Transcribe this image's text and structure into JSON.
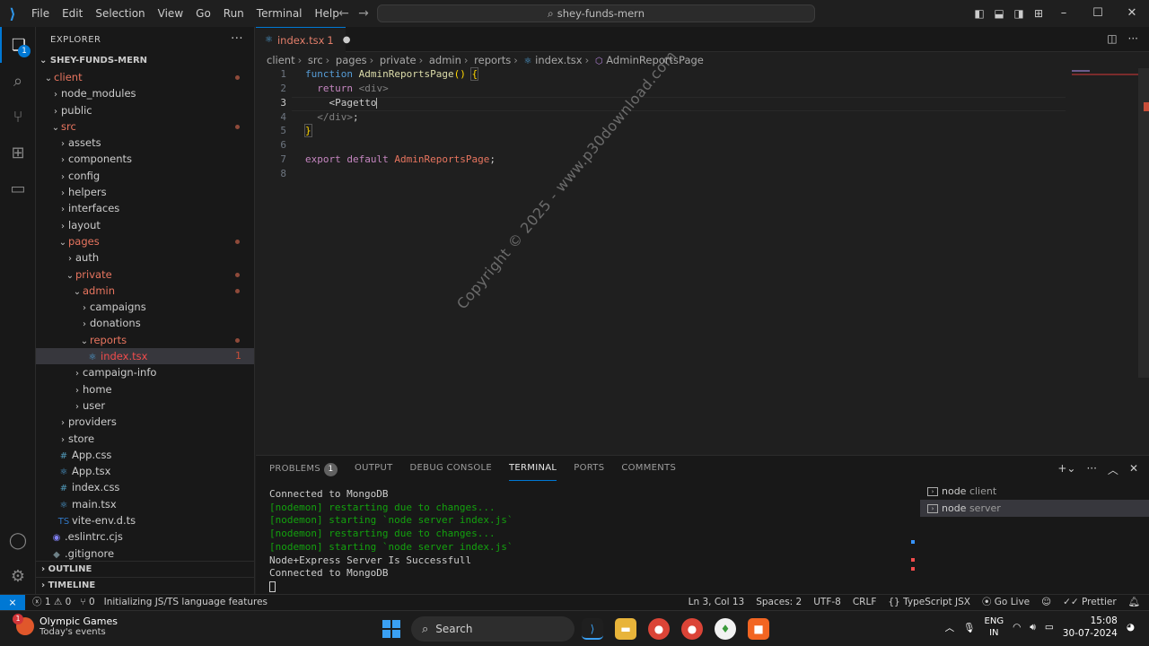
{
  "titlebar": {
    "menu": [
      "File",
      "Edit",
      "Selection",
      "View",
      "Go",
      "Run",
      "Terminal",
      "Help"
    ],
    "command_center": "shey-funds-mern"
  },
  "explorer": {
    "title": "EXPLORER",
    "root": "SHEY-FUNDS-MERN",
    "tree": [
      {
        "label": "client",
        "depth": 0,
        "type": "folder-open",
        "state": "dot"
      },
      {
        "label": "node_modules",
        "depth": 1,
        "type": "folder",
        "state": ""
      },
      {
        "label": "public",
        "depth": 1,
        "type": "folder",
        "state": ""
      },
      {
        "label": "src",
        "depth": 1,
        "type": "folder-open",
        "state": "dot"
      },
      {
        "label": "assets",
        "depth": 2,
        "type": "folder",
        "state": ""
      },
      {
        "label": "components",
        "depth": 2,
        "type": "folder",
        "state": ""
      },
      {
        "label": "config",
        "depth": 2,
        "type": "folder",
        "state": ""
      },
      {
        "label": "helpers",
        "depth": 2,
        "type": "folder",
        "state": ""
      },
      {
        "label": "interfaces",
        "depth": 2,
        "type": "folder",
        "state": ""
      },
      {
        "label": "layout",
        "depth": 2,
        "type": "folder",
        "state": ""
      },
      {
        "label": "pages",
        "depth": 2,
        "type": "folder-open",
        "state": "dot"
      },
      {
        "label": "auth",
        "depth": 3,
        "type": "folder",
        "state": ""
      },
      {
        "label": "private",
        "depth": 3,
        "type": "folder-open",
        "state": "dot"
      },
      {
        "label": "admin",
        "depth": 4,
        "type": "folder-open",
        "state": "dot"
      },
      {
        "label": "campaigns",
        "depth": 5,
        "type": "folder",
        "state": ""
      },
      {
        "label": "donations",
        "depth": 5,
        "type": "folder",
        "state": ""
      },
      {
        "label": "reports",
        "depth": 5,
        "type": "folder-open",
        "state": "dot"
      },
      {
        "label": "index.tsx",
        "depth": 6,
        "type": "tsx",
        "state": "1",
        "selected": true
      },
      {
        "label": "campaign-info",
        "depth": 4,
        "type": "folder",
        "state": ""
      },
      {
        "label": "home",
        "depth": 4,
        "type": "folder",
        "state": ""
      },
      {
        "label": "user",
        "depth": 4,
        "type": "folder",
        "state": ""
      },
      {
        "label": "providers",
        "depth": 2,
        "type": "folder",
        "state": ""
      },
      {
        "label": "store",
        "depth": 2,
        "type": "folder",
        "state": ""
      },
      {
        "label": "App.css",
        "depth": 2,
        "type": "css",
        "state": ""
      },
      {
        "label": "App.tsx",
        "depth": 2,
        "type": "tsx",
        "state": ""
      },
      {
        "label": "index.css",
        "depth": 2,
        "type": "css",
        "state": ""
      },
      {
        "label": "main.tsx",
        "depth": 2,
        "type": "tsx",
        "state": ""
      },
      {
        "label": "vite-env.d.ts",
        "depth": 2,
        "type": "ts",
        "state": ""
      },
      {
        "label": ".eslintrc.cjs",
        "depth": 1,
        "type": "eslint",
        "state": ""
      },
      {
        "label": ".gitignore",
        "depth": 1,
        "type": "git",
        "state": ""
      }
    ],
    "outline": "OUTLINE",
    "timeline": "TIMELINE"
  },
  "tab": {
    "label": "index.tsx",
    "problems": "1"
  },
  "breadcrumbs": [
    "client",
    "src",
    "pages",
    "private",
    "admin",
    "reports",
    "index.tsx",
    "AdminReportsPage"
  ],
  "code": {
    "line_numbers": [
      "1",
      "2",
      "3",
      "4",
      "5",
      "6",
      "7",
      "8"
    ],
    "l1_kw": "function",
    "l1_fn": "AdminReportsPage",
    "l1_paren": "()",
    "l1_brace": "{",
    "l2_kw": "return",
    "l2_tag": "<div>",
    "l3_text": "<Pagetto",
    "l4_tag": "</div>",
    "l4_semi": ";",
    "l5_brace": "}",
    "l7_kw1": "export",
    "l7_kw2": "default",
    "l7_name": "AdminReportsPage",
    "l7_semi": ";"
  },
  "watermark": "Copyright © 2025 - www.p30download.com",
  "panel": {
    "tabs": [
      "PROBLEMS",
      "OUTPUT",
      "DEBUG CONSOLE",
      "TERMINAL",
      "PORTS",
      "COMMENTS"
    ],
    "problems_count": "1",
    "active_tab": "TERMINAL",
    "terminal_lines": [
      {
        "text": "Connected to MongoDB",
        "green": false
      },
      {
        "text": "[nodemon] restarting due to changes...",
        "green": true
      },
      {
        "text": "[nodemon] starting `node server index.js`",
        "green": true
      },
      {
        "text": "[nodemon] restarting due to changes...",
        "green": true
      },
      {
        "text": "[nodemon] starting `node server index.js`",
        "green": true
      },
      {
        "text": "Node+Express Server Is Successfull",
        "green": false
      },
      {
        "text": "Connected to MongoDB",
        "green": false
      }
    ],
    "terminals": [
      {
        "name": "node",
        "label": "client",
        "selected": false
      },
      {
        "name": "node",
        "label": "server",
        "selected": true
      }
    ]
  },
  "statusbar": {
    "errors": "1",
    "warnings": "0",
    "ports": "0",
    "message": "Initializing JS/TS language features",
    "position": "Ln 3, Col 13",
    "spaces": "Spaces: 2",
    "encoding": "UTF-8",
    "eol": "CRLF",
    "language": "TypeScript JSX",
    "golive": "Go Live",
    "prettier": "Prettier"
  },
  "taskbar": {
    "weather_title": "Olympic Games",
    "weather_sub": "Today's events",
    "weather_badge": "1",
    "search": "Search",
    "lang1": "ENG",
    "lang2": "IN",
    "time": "15:08",
    "date": "30-07-2024"
  },
  "colors": {
    "accent": "#0078d4",
    "error": "#f14c4c",
    "modified": "#e8755f"
  }
}
